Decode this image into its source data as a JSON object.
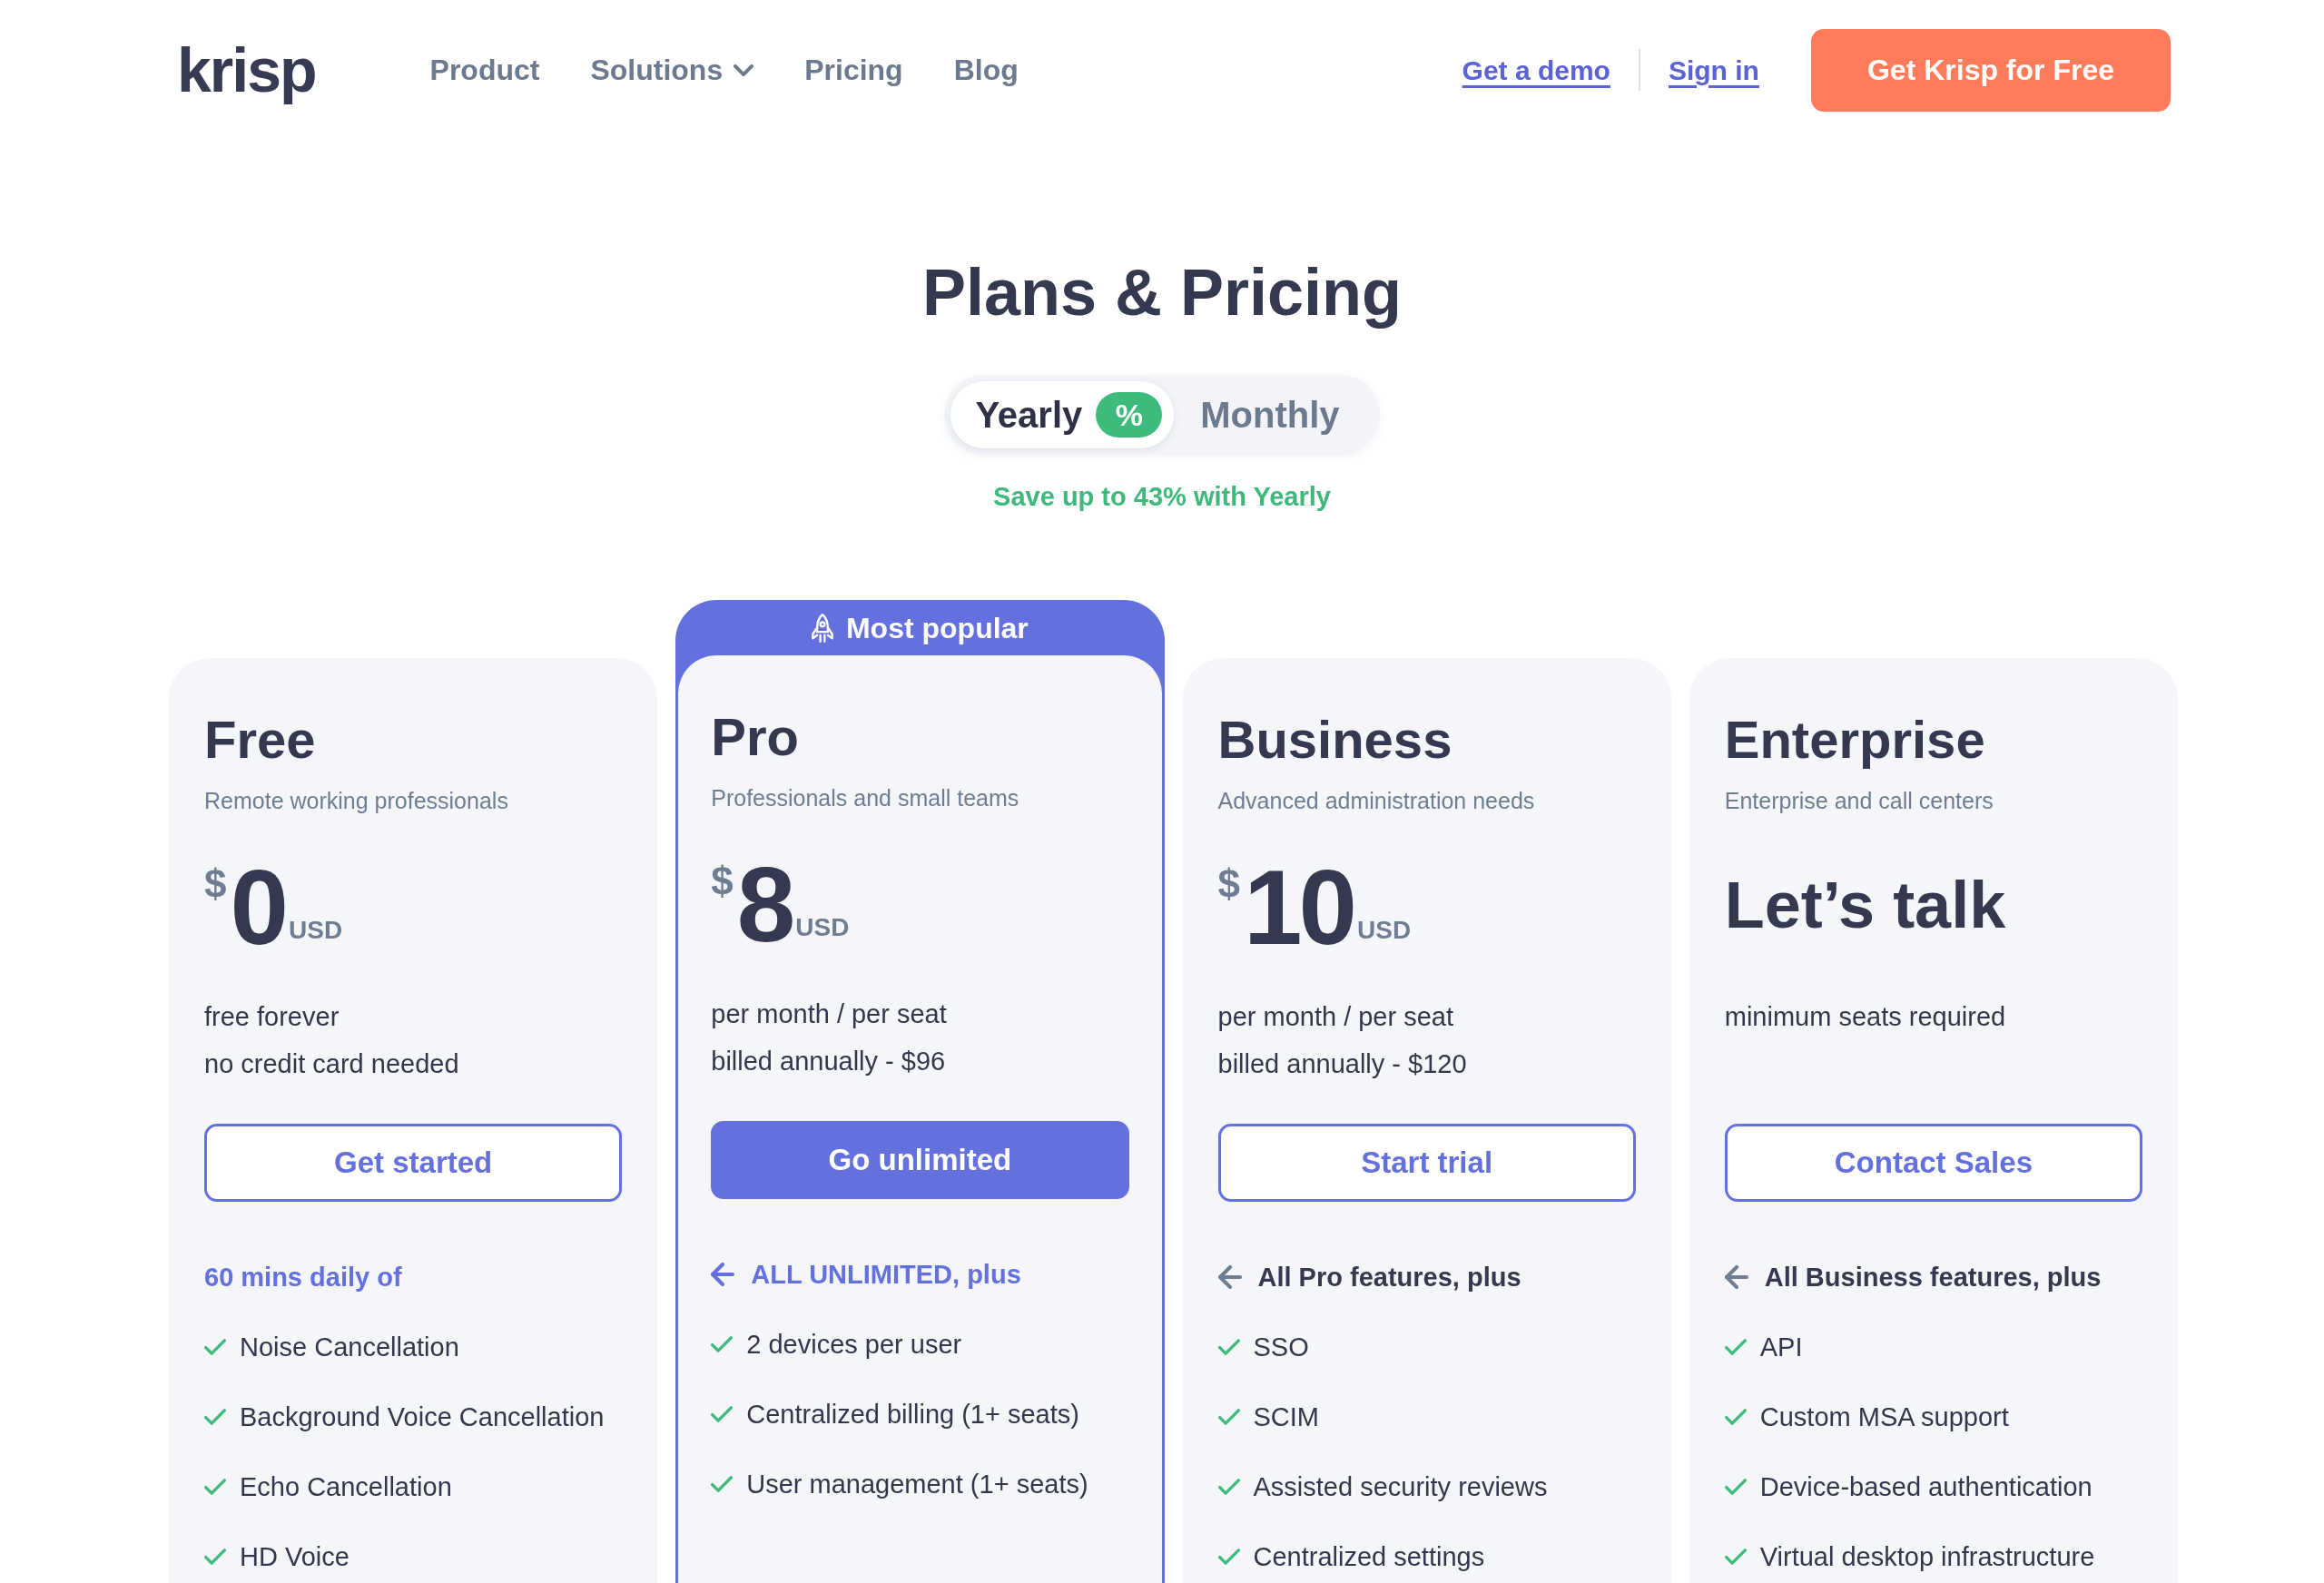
{
  "header": {
    "logo": "krisp",
    "nav": [
      {
        "label": "Product",
        "has_menu": false
      },
      {
        "label": "Solutions",
        "has_menu": true
      },
      {
        "label": "Pricing",
        "has_menu": false
      },
      {
        "label": "Blog",
        "has_menu": false
      }
    ],
    "links": [
      "Get a demo",
      "Sign in"
    ],
    "cta": "Get Krisp for Free"
  },
  "title": "Plans & Pricing",
  "billing_toggle": {
    "options": [
      {
        "label": "Yearly",
        "selected": true,
        "badge": "%"
      },
      {
        "label": "Monthly",
        "selected": false
      }
    ],
    "note": "Save up to 43% with Yearly"
  },
  "plans": [
    {
      "name": "Free",
      "subtitle": "Remote working professionals",
      "highlighted": false,
      "price": {
        "currency": "$",
        "amount": "0",
        "unit": "USD"
      },
      "notes": [
        "free forever",
        "no credit card needed"
      ],
      "button": {
        "label": "Get started",
        "primary": false
      },
      "features_heading": {
        "text": "60 mins daily of",
        "arrow": false,
        "accent": true
      },
      "features": [
        "Noise Cancellation",
        "Background Voice Cancellation",
        "Echo Cancellation",
        "HD Voice"
      ]
    },
    {
      "name": "Pro",
      "badge": "Most popular",
      "subtitle": "Professionals and small teams",
      "highlighted": true,
      "price": {
        "currency": "$",
        "amount": "8",
        "unit": "USD"
      },
      "notes": [
        "per month / per seat",
        "billed annually - $96"
      ],
      "button": {
        "label": "Go unlimited",
        "primary": true
      },
      "features_heading": {
        "text": "ALL UNLIMITED, plus",
        "arrow": true,
        "accent": true
      },
      "features": [
        "2 devices per user",
        "Centralized billing (1+ seats)",
        "User management (1+ seats)"
      ]
    },
    {
      "name": "Business",
      "subtitle": "Advanced administration needs",
      "highlighted": false,
      "price": {
        "currency": "$",
        "amount": "10",
        "unit": "USD"
      },
      "notes": [
        "per month / per seat",
        "billed annually - $120"
      ],
      "button": {
        "label": "Start trial",
        "primary": false
      },
      "features_heading": {
        "text": "All Pro features, plus",
        "arrow": true,
        "accent": false
      },
      "features": [
        "SSO",
        "SCIM",
        "Assisted security reviews",
        "Centralized settings"
      ]
    },
    {
      "name": "Enterprise",
      "subtitle": "Enterprise and call centers",
      "highlighted": false,
      "price": {
        "text": "Let’s talk"
      },
      "notes": [
        "minimum seats required"
      ],
      "button": {
        "label": "Contact Sales",
        "primary": false
      },
      "features_heading": {
        "text": "All Business features, plus",
        "arrow": true,
        "accent": false
      },
      "features": [
        "API",
        "Custom MSA support",
        "Device-based authentication",
        "Virtual desktop infrastructure"
      ]
    }
  ]
}
